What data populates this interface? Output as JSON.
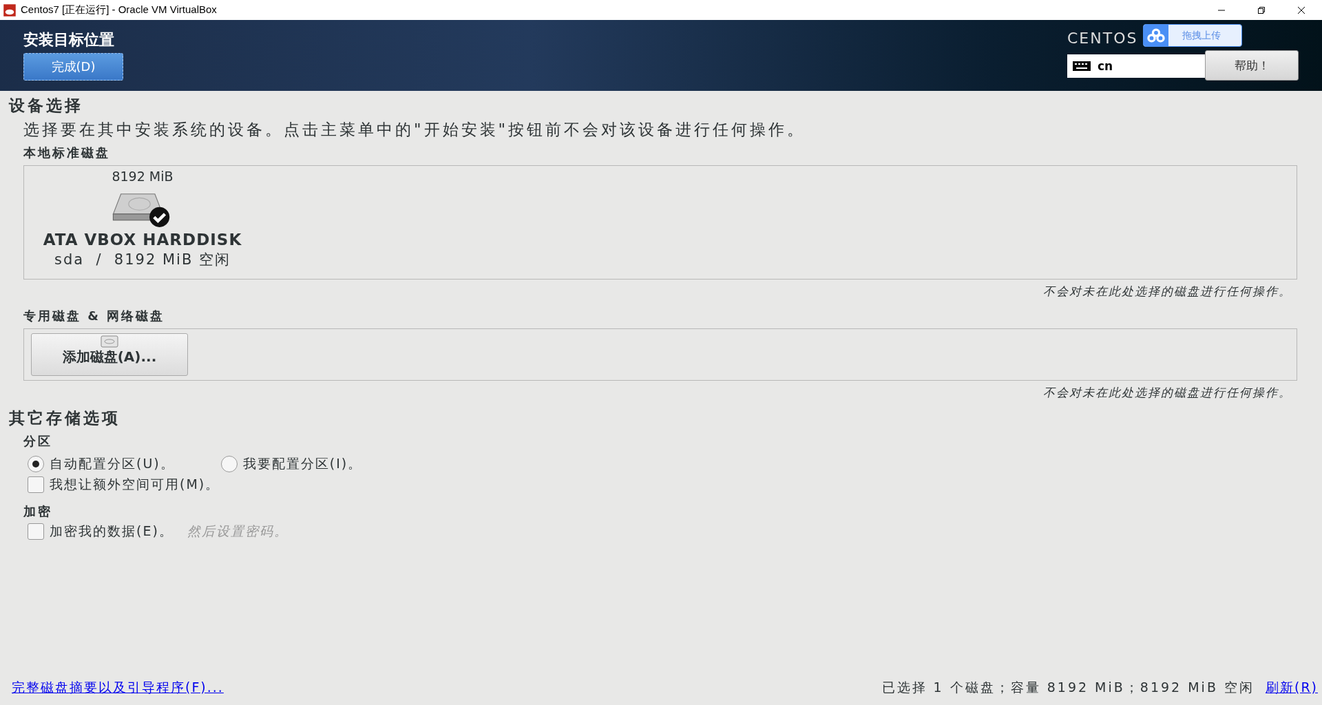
{
  "window": {
    "title": "Centos7 [正在运行] - Oracle VM VirtualBox"
  },
  "header": {
    "title": "安装目标位置",
    "done_button": "完成(D)",
    "product": "CENTOS",
    "keyboard": "cn",
    "help_button": "帮助！"
  },
  "upload_overlay": {
    "label": "拖拽上传"
  },
  "device_selection": {
    "title": "设备选择",
    "description": "选择要在其中安装系统的设备。点击主菜单中的\"开始安装\"按钮前不会对该设备进行任何操作。",
    "local_disks": {
      "title": "本地标准磁盘",
      "disks": [
        {
          "size": "8192 MiB",
          "name": "ATA VBOX HARDDISK",
          "detail": "sda  /  8192 MiB 空闲",
          "selected": true
        }
      ],
      "note": "不会对未在此处选择的磁盘进行任何操作。"
    },
    "special_disks": {
      "title": "专用磁盘 & 网络磁盘",
      "add_button": "添加磁盘(A)...",
      "note": "不会对未在此处选择的磁盘进行任何操作。"
    }
  },
  "other_options": {
    "title": "其它存储选项",
    "partitioning": {
      "title": "分区",
      "radios": [
        {
          "label": "自动配置分区(U)。",
          "selected": true
        },
        {
          "label": "我要配置分区(I)。",
          "selected": false
        }
      ],
      "extra_space": {
        "label": "我想让额外空间可用(M)。",
        "checked": false
      }
    },
    "encryption": {
      "title": "加密",
      "checkbox": {
        "label": "加密我的数据(E)。",
        "checked": false
      },
      "hint": "然后设置密码。"
    }
  },
  "footer": {
    "summary_link": "完整磁盘摘要以及引导程序(F)...",
    "status": "已选择 1 个磁盘；容量 8192 MiB；8192 MiB 空闲",
    "refresh_link": "刷新(R)"
  }
}
